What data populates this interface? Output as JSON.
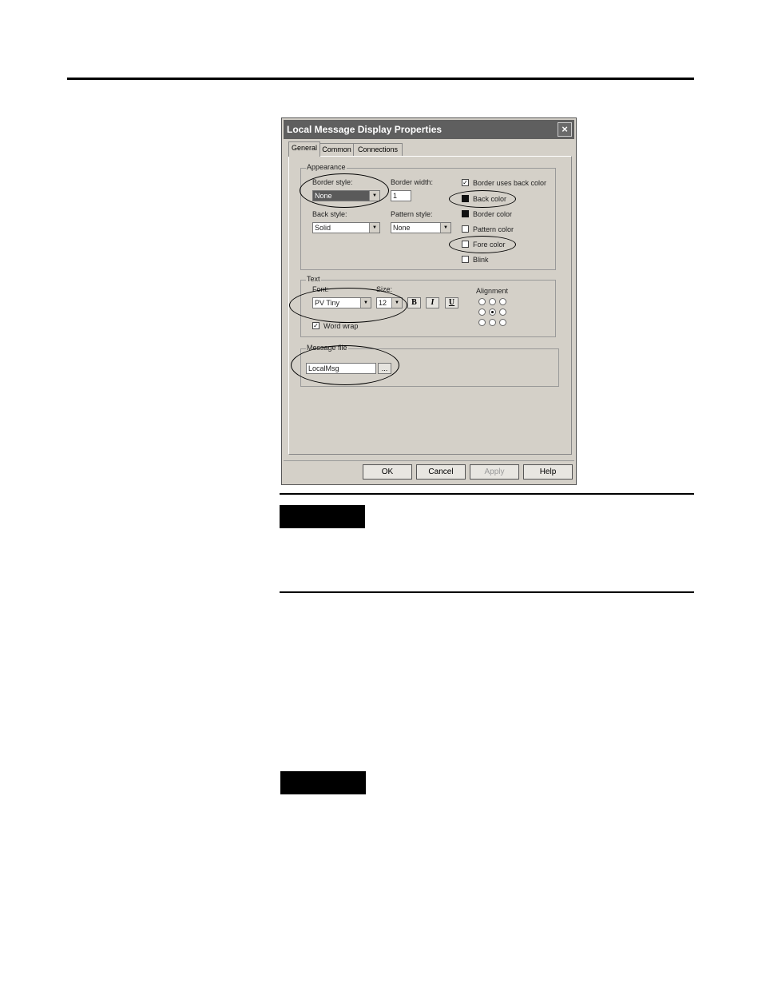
{
  "dialog": {
    "title": "Local Message Display Properties",
    "close_glyph": "×",
    "tabs": [
      {
        "label": "General"
      },
      {
        "label": "Common"
      },
      {
        "label": "Connections"
      }
    ],
    "appearance": {
      "group_label": "Appearance",
      "border_style_label": "Border style:",
      "border_style_value": "None",
      "border_width_label": "Border width:",
      "border_width_value": "1",
      "back_style_label": "Back style:",
      "back_style_value": "Solid",
      "pattern_style_label": "Pattern style:",
      "pattern_style_value": "None",
      "border_uses_back_color": "Border uses back color",
      "back_color": "Back color",
      "border_color": "Border color",
      "pattern_color": "Pattern color",
      "fore_color": "Fore color",
      "blink": "Blink"
    },
    "text": {
      "group_label": "Text",
      "font_label": "Font:",
      "font_value": "PV Tiny",
      "size_label": "Size:",
      "size_value": "12",
      "bold": "B",
      "italic": "I",
      "underline": "U",
      "alignment_label": "Alignment",
      "word_wrap": "Word wrap",
      "check_glyph": "✓"
    },
    "message_file": {
      "group_label": "Message file",
      "value": "LocalMsg",
      "browse": "..."
    },
    "buttons": {
      "ok": "OK",
      "cancel": "Cancel",
      "apply": "Apply",
      "help": "Help"
    },
    "combo_arrow": "▼"
  }
}
